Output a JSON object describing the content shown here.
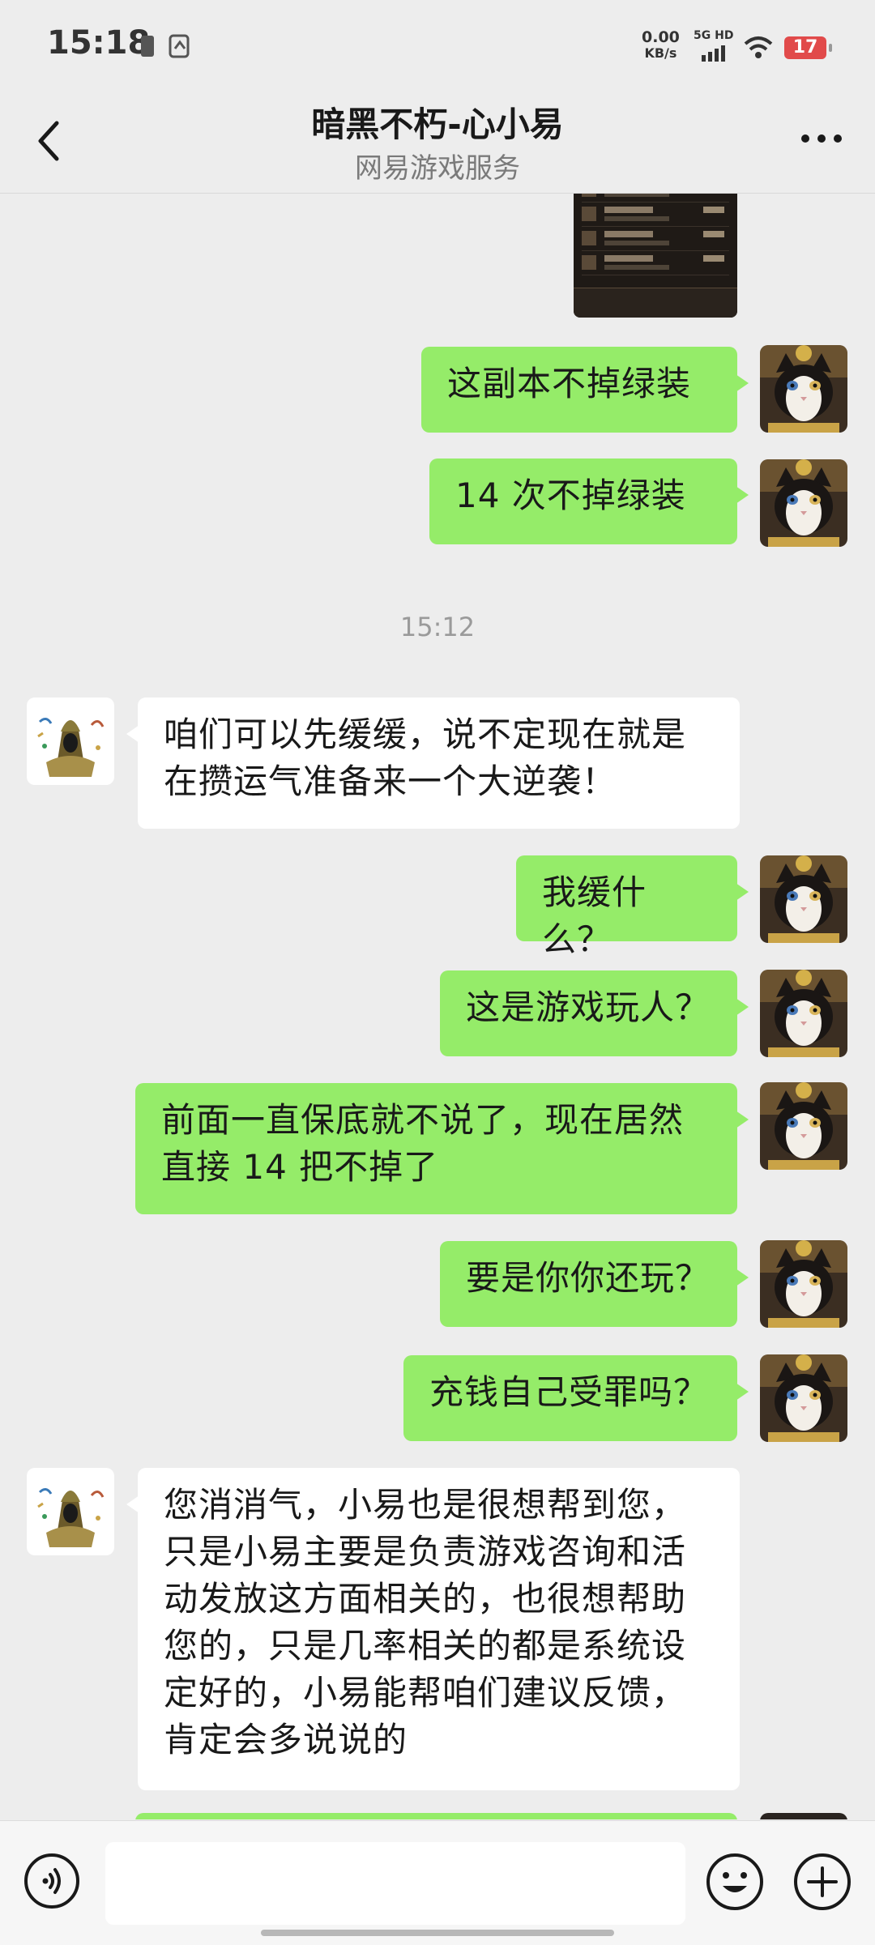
{
  "status_bar": {
    "time": "15:18",
    "net_speed_value": "0.00",
    "net_speed_unit": "KB/s",
    "network_type": "5G HD",
    "battery": "17"
  },
  "header": {
    "title": "暗黑不朽-心小易",
    "subtitle": "网易游戏服务"
  },
  "messages": [
    {
      "from": "me",
      "text": "这副本不掉绿装"
    },
    {
      "from": "me",
      "text": "14 次不掉绿装"
    },
    {
      "type": "timestamp",
      "text": "15:12"
    },
    {
      "from": "them",
      "text": "咱们可以先缓缓，说不定现在就是在攒运气准备来一个大逆袭！"
    },
    {
      "from": "me",
      "text": "我缓什么？"
    },
    {
      "from": "me",
      "text": "这是游戏玩人？"
    },
    {
      "from": "me",
      "text": "前面一直保底就不说了，现在居然直接 14 把不掉了"
    },
    {
      "from": "me",
      "text": "要是你你还玩？"
    },
    {
      "from": "me",
      "text": "充钱自己受罪吗？"
    },
    {
      "from": "them",
      "text": "您消消气，小易也是很想帮到您，只是小易主要是负责游戏咨询和活动发放这方面相关的，也很想帮助您的，只是几率相关的都是系统设定好的，小易能帮咱们建议反馈，肯定会多说说的"
    }
  ],
  "input_bar": {
    "placeholder": ""
  },
  "colors": {
    "my_bubble": "#95ec69",
    "their_bubble": "#ffffff",
    "background": "#ededed",
    "battery_low": "#e14a4a"
  },
  "icons": {
    "back": "chevron-left-icon",
    "more": "more-dots-icon",
    "voice": "voice-icon",
    "emoji": "emoji-icon",
    "plus": "plus-icon"
  }
}
